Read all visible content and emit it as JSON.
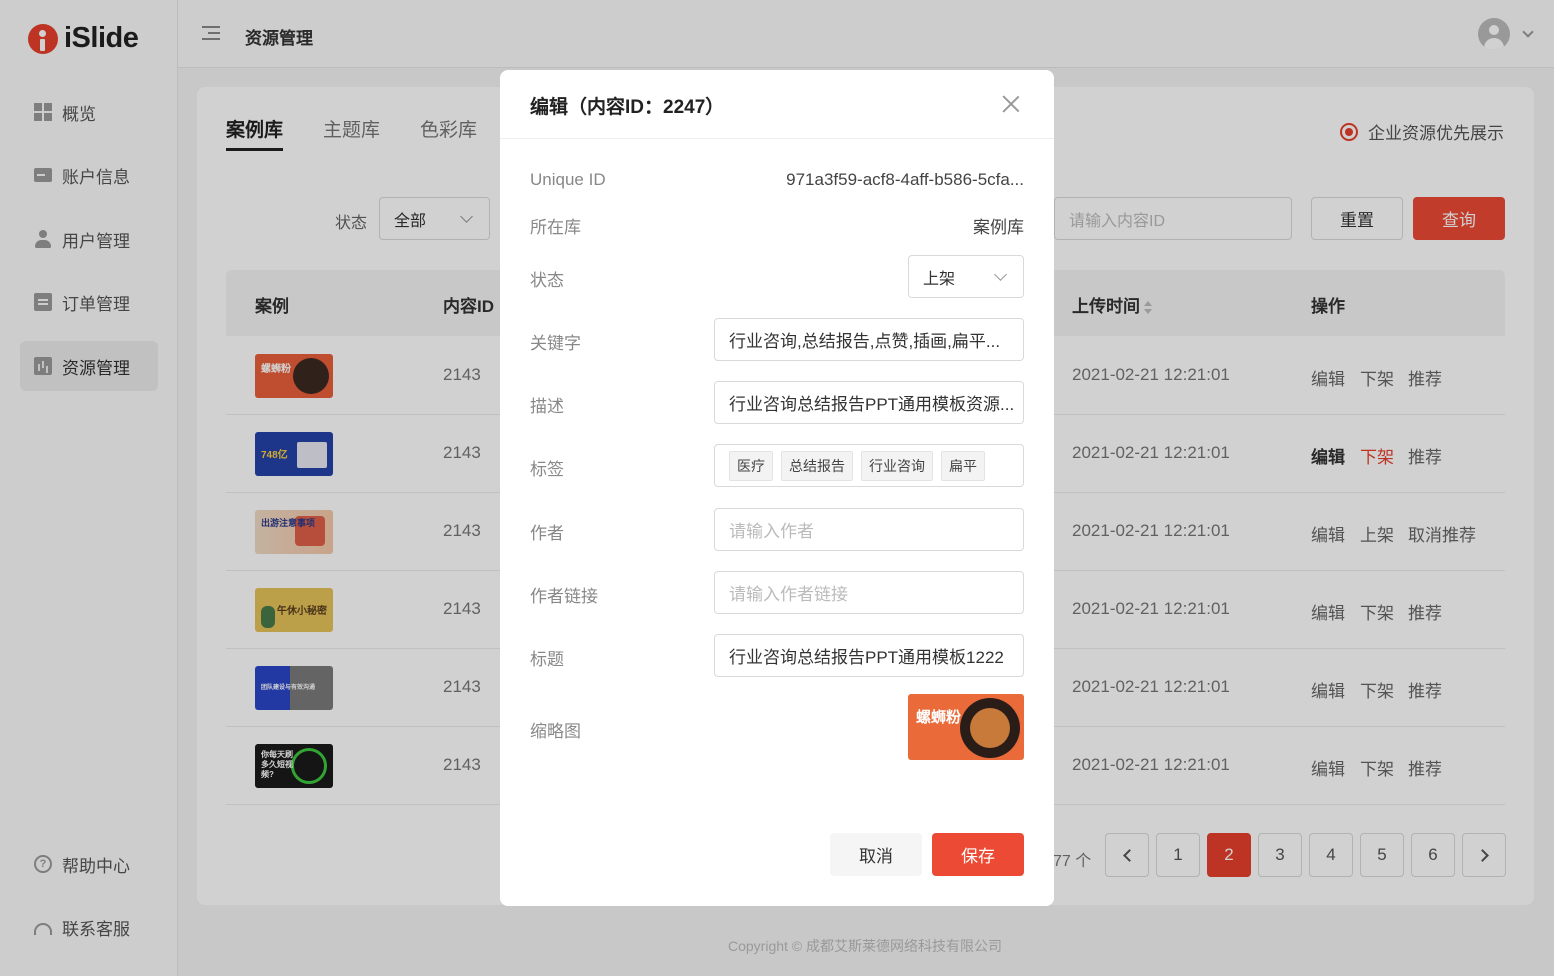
{
  "app": {
    "logo_text": "iSlide",
    "accent": "#e8402c"
  },
  "sidebar": {
    "items": [
      {
        "label": "概览",
        "icon": "dashboard-icon"
      },
      {
        "label": "账户信息",
        "icon": "id-card-icon"
      },
      {
        "label": "用户管理",
        "icon": "user-icon"
      },
      {
        "label": "订单管理",
        "icon": "clipboard-icon"
      },
      {
        "label": "资源管理",
        "icon": "chart-icon",
        "active": true
      }
    ],
    "bottom": [
      {
        "label": "帮助中心",
        "icon": "help-icon"
      },
      {
        "label": "联系客服",
        "icon": "headset-icon"
      }
    ]
  },
  "header": {
    "title": "资源管理"
  },
  "tabs": [
    "案例库",
    "主题库",
    "色彩库"
  ],
  "priority_label": "企业资源优先展示",
  "filters": {
    "status_label": "状态",
    "status_value": "全部",
    "id_placeholder": "请输入内容ID",
    "reset": "重置",
    "query": "查询"
  },
  "table": {
    "headers": {
      "case": "案例",
      "id": "内容ID",
      "time": "上传时间",
      "ops": "操作"
    },
    "rows": [
      {
        "thumb_text": "螺蛳粉",
        "id": "2143",
        "time": "2021-02-21 12:21:01",
        "ops": [
          "编辑",
          "下架",
          "推荐"
        ]
      },
      {
        "thumb_text": "748亿",
        "id": "2143",
        "time": "2021-02-21 12:21:01",
        "ops": [
          "编辑",
          "下架",
          "推荐"
        ]
      },
      {
        "thumb_text": "出游注意事项",
        "id": "2143",
        "time": "2021-02-21 12:21:01",
        "ops": [
          "编辑",
          "上架",
          "取消推荐"
        ]
      },
      {
        "thumb_text": "午休小秘密",
        "id": "2143",
        "time": "2021-02-21 12:21:01",
        "ops": [
          "编辑",
          "下架",
          "推荐"
        ]
      },
      {
        "thumb_text": "团队建设与有效沟通",
        "id": "2143",
        "time": "2021-02-21 12:21:01",
        "ops": [
          "编辑",
          "下架",
          "推荐"
        ]
      },
      {
        "thumb_text": "你每天刷多久短视频?",
        "id": "2143",
        "time": "2021-02-21 12:21:01",
        "ops": [
          "编辑",
          "下架",
          "推荐"
        ]
      }
    ]
  },
  "pagination": {
    "total": "77 个",
    "pages": [
      "1",
      "2",
      "3",
      "4",
      "5",
      "6"
    ],
    "current": "2"
  },
  "footer": {
    "copyright": "Copyright © 成都艾斯莱德网络科技有限公司"
  },
  "modal": {
    "title": "编辑（内容ID：2247）",
    "fields": {
      "uid_label": "Unique ID",
      "uid_value": "971a3f59-acf8-4aff-b586-5cfa...",
      "lib_label": "所在库",
      "lib_value": "案例库",
      "status_label": "状态",
      "status_value": "上架",
      "keyword_label": "关键字",
      "keyword_value": "行业咨询,总结报告,点赞,插画,扁平...",
      "desc_label": "描述",
      "desc_value": "行业咨询总结报告PPT通用模板资源...",
      "tags_label": "标签",
      "tags": [
        "医疗",
        "总结报告",
        "行业咨询",
        "扁平"
      ],
      "author_label": "作者",
      "author_placeholder": "请输入作者",
      "author_link_label": "作者链接",
      "author_link_placeholder": "请输入作者链接",
      "title_label": "标题",
      "title_value": "行业咨询总结报告PPT通用模板1222",
      "thumb_label": "缩略图",
      "thumb_text": "螺蛳粉"
    },
    "cancel": "取消",
    "save": "保存"
  }
}
